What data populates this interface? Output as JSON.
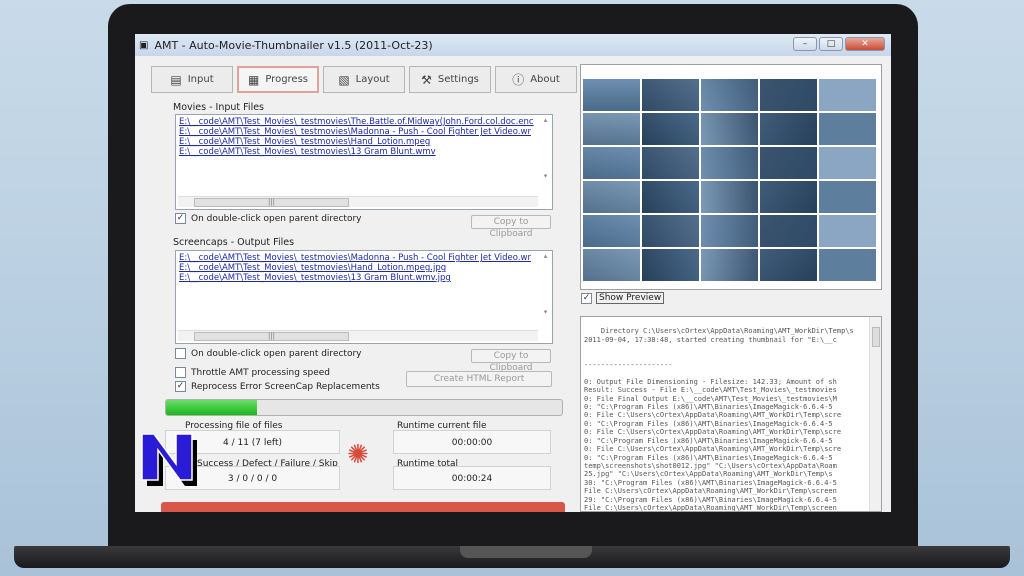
{
  "window": {
    "title": "AMT - Auto-Movie-Thumbnailer v1.5 (2011-Oct-23)",
    "minimize": "–",
    "maximize": "□",
    "close": "✕"
  },
  "tabs": [
    {
      "label": "Input",
      "icon": "input-icon",
      "glyph": "▤"
    },
    {
      "label": "Progress",
      "icon": "progress-icon",
      "glyph": "▦"
    },
    {
      "label": "Layout",
      "icon": "layout-icon",
      "glyph": "▧"
    },
    {
      "label": "Settings",
      "icon": "settings-icon",
      "glyph": "⚒"
    },
    {
      "label": "About",
      "icon": "about-icon",
      "glyph": "ⓘ"
    }
  ],
  "input_files": {
    "label": "Movies - Input Files",
    "items": [
      "E:\\__code\\AMT\\Test_Movies\\_testmovies\\The.Battle.of.Midway(John.Ford.col.doc.enc",
      "E:\\__code\\AMT\\Test_Movies\\_testmovies\\Madonna - Push - Cool Fighter Jet Video.wr",
      "E:\\__code\\AMT\\Test_Movies\\_testmovies\\Hand_Lotion.mpeg",
      "E:\\__code\\AMT\\Test_Movies\\_testmovies\\13 Gram Blunt.wmv"
    ],
    "checkbox": "On double-click open parent directory",
    "copy": "Copy to Clipboard"
  },
  "output_files": {
    "label": "Screencaps - Output Files",
    "items": [
      "E:\\__code\\AMT\\Test_Movies\\_testmovies\\Madonna - Push - Cool Fighter Jet Video.wr",
      "E:\\__code\\AMT\\Test_Movies\\_testmovies\\Hand_Lotion.mpeg.jpg",
      "E:\\__code\\AMT\\Test_Movies\\_testmovies\\13 Gram Blunt.wmv.jpg"
    ],
    "checkbox": "On double-click open parent directory",
    "copy": "Copy to Clipboard"
  },
  "options": {
    "throttle": "Throttle AMT processing speed",
    "reprocess": "Reprocess Error ScreenCap Replacements",
    "create_html": "Create HTML Report"
  },
  "progress": {
    "fraction": 0.23
  },
  "stats": {
    "processing_label": "Processing file of files",
    "processing_value": "4 / 11 (7 left)",
    "success_label": "Success / Defect / Failure / Skip",
    "success_value": "3 / 0 / 0 / 0",
    "runtime_current_label": "Runtime current file",
    "runtime_current_value": "00:00:00",
    "runtime_total_label": "Runtime total",
    "runtime_total_value": "00:00:24"
  },
  "preview": {
    "show_label": "Show Preview"
  },
  "log": {
    "text": "Directory C:\\Users\\cOrtex\\AppData\\Roaming\\AMT_WorkDir\\Temp\\s\n2011-09-04, 17:38:48, started creating thumbnail for \"E:\\__c\n\n\n---------------------\n\n0: Output File Dimensioning - Filesize: 142.33; Amount of sh\nResult: Success - File E:\\__code\\AMT\\Test_Movies\\_testmovies\n0: File Final Output E:\\__code\\AMT\\Test_Movies\\_testmovies\\M\n0: \"C:\\Program Files (x86)\\AMT\\Binaries\\ImageMagick-6.6.4-5\n0: File C:\\Users\\cOrtex\\AppData\\Roaming\\AMT_WorkDir\\Temp\\scre\n0: \"C:\\Program Files (x86)\\AMT\\Binaries\\ImageMagick-6.6.4-5\n0: File C:\\Users\\cOrtex\\AppData\\Roaming\\AMT_WorkDir\\Temp\\scre\n0: \"C:\\Program Files (x86)\\AMT\\Binaries\\ImageMagick-6.6.4-5\n0: File C:\\Users\\cOrtex\\AppData\\Roaming\\AMT_WorkDir\\Temp\\scre\n0: \"C:\\Program Files (x86)\\AMT\\Binaries\\ImageMagick-6.6.4-5\ntemp\\screenshots\\shot0012.jpg\" \"C:\\Users\\cOrtex\\AppData\\Roam\n25.jpg\" \"C:\\Users\\cOrtex\\AppData\\Roaming\\AMT_WorkDir\\Temp\\s\n30: \"C:\\Program Files (x86)\\AMT\\Binaries\\ImageMagick-6.6.4-5\nFile C:\\Users\\cOrtex\\AppData\\Roaming\\AMT_WorkDir\\Temp\\screen\n29: \"C:\\Program Files (x86)\\AMT\\Binaries\\ImageMagick-6.6.4-5\nFile C:\\Users\\cOrtex\\AppData\\Roaming\\AMT_WorkDir\\Temp\\screen\n28: \"C:\\Program Files (x86)\\AMT\\Binaries\\ImageMagick-6.6.4-5\nFile C:\\Users\\cOrtex\\AppData\\Roaming\\AMT_WorkDir\\Temp\\screen"
  },
  "colors": {
    "progress_fill": "#18b818",
    "link": "#1d2aa0",
    "logo_fill": "#2a1cd6",
    "logo_stroke": "#ffffff"
  }
}
